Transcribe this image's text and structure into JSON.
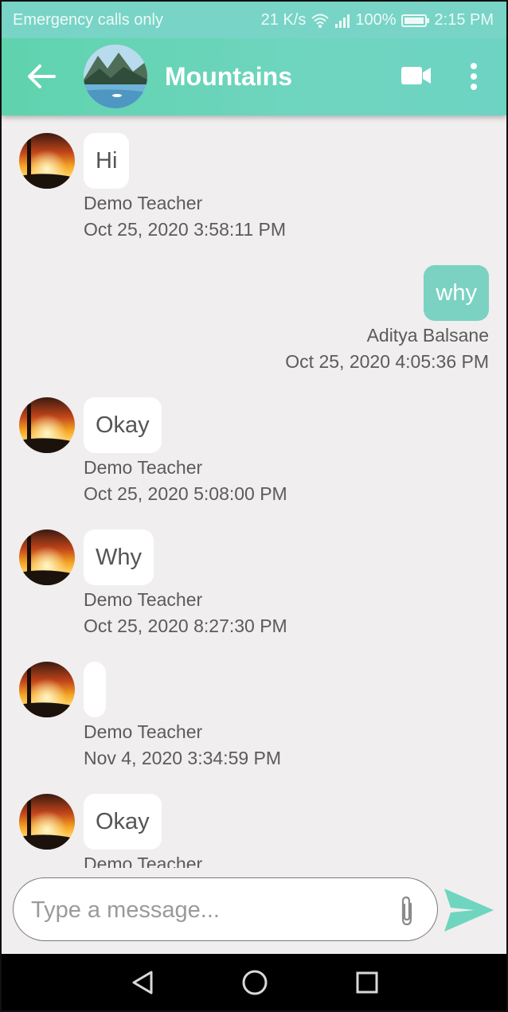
{
  "status_bar": {
    "carrier": "Emergency calls only",
    "speed": "21 K/s",
    "battery": "100%",
    "time": "2:15 PM"
  },
  "app_bar": {
    "title": "Mountains",
    "back_icon": "arrow-left",
    "video_icon": "video-camera",
    "more_icon": "vertical-dots"
  },
  "messages": [
    {
      "text": "Hi",
      "sender": "Demo Teacher",
      "timestamp": "Oct 25, 2020 3:58:11 PM",
      "mine": false
    },
    {
      "text": "why",
      "sender": "Aditya Balsane",
      "timestamp": "Oct 25, 2020 4:05:36 PM",
      "mine": true
    },
    {
      "text": "Okay",
      "sender": "Demo Teacher",
      "timestamp": "Oct 25, 2020 5:08:00 PM",
      "mine": false
    },
    {
      "text": "Why",
      "sender": "Demo Teacher",
      "timestamp": "Oct 25, 2020 8:27:30 PM",
      "mine": false
    },
    {
      "text": "",
      "sender": "Demo Teacher",
      "timestamp": "Nov 4, 2020 3:34:59 PM",
      "mine": false
    },
    {
      "text": "Okay",
      "sender": "Demo Teacher",
      "timestamp": "",
      "mine": false
    }
  ],
  "composer": {
    "placeholder": "Type a message...",
    "value": "",
    "attach_icon": "paperclip",
    "send_icon": "send-arrow"
  },
  "colors": {
    "accent": "#6fd5bf",
    "my_bubble": "#7bd2c2",
    "background": "#f0eeef"
  },
  "nav_bar": {
    "back_icon": "triangle-back",
    "home_icon": "circle-home",
    "recent_icon": "square-recents"
  }
}
